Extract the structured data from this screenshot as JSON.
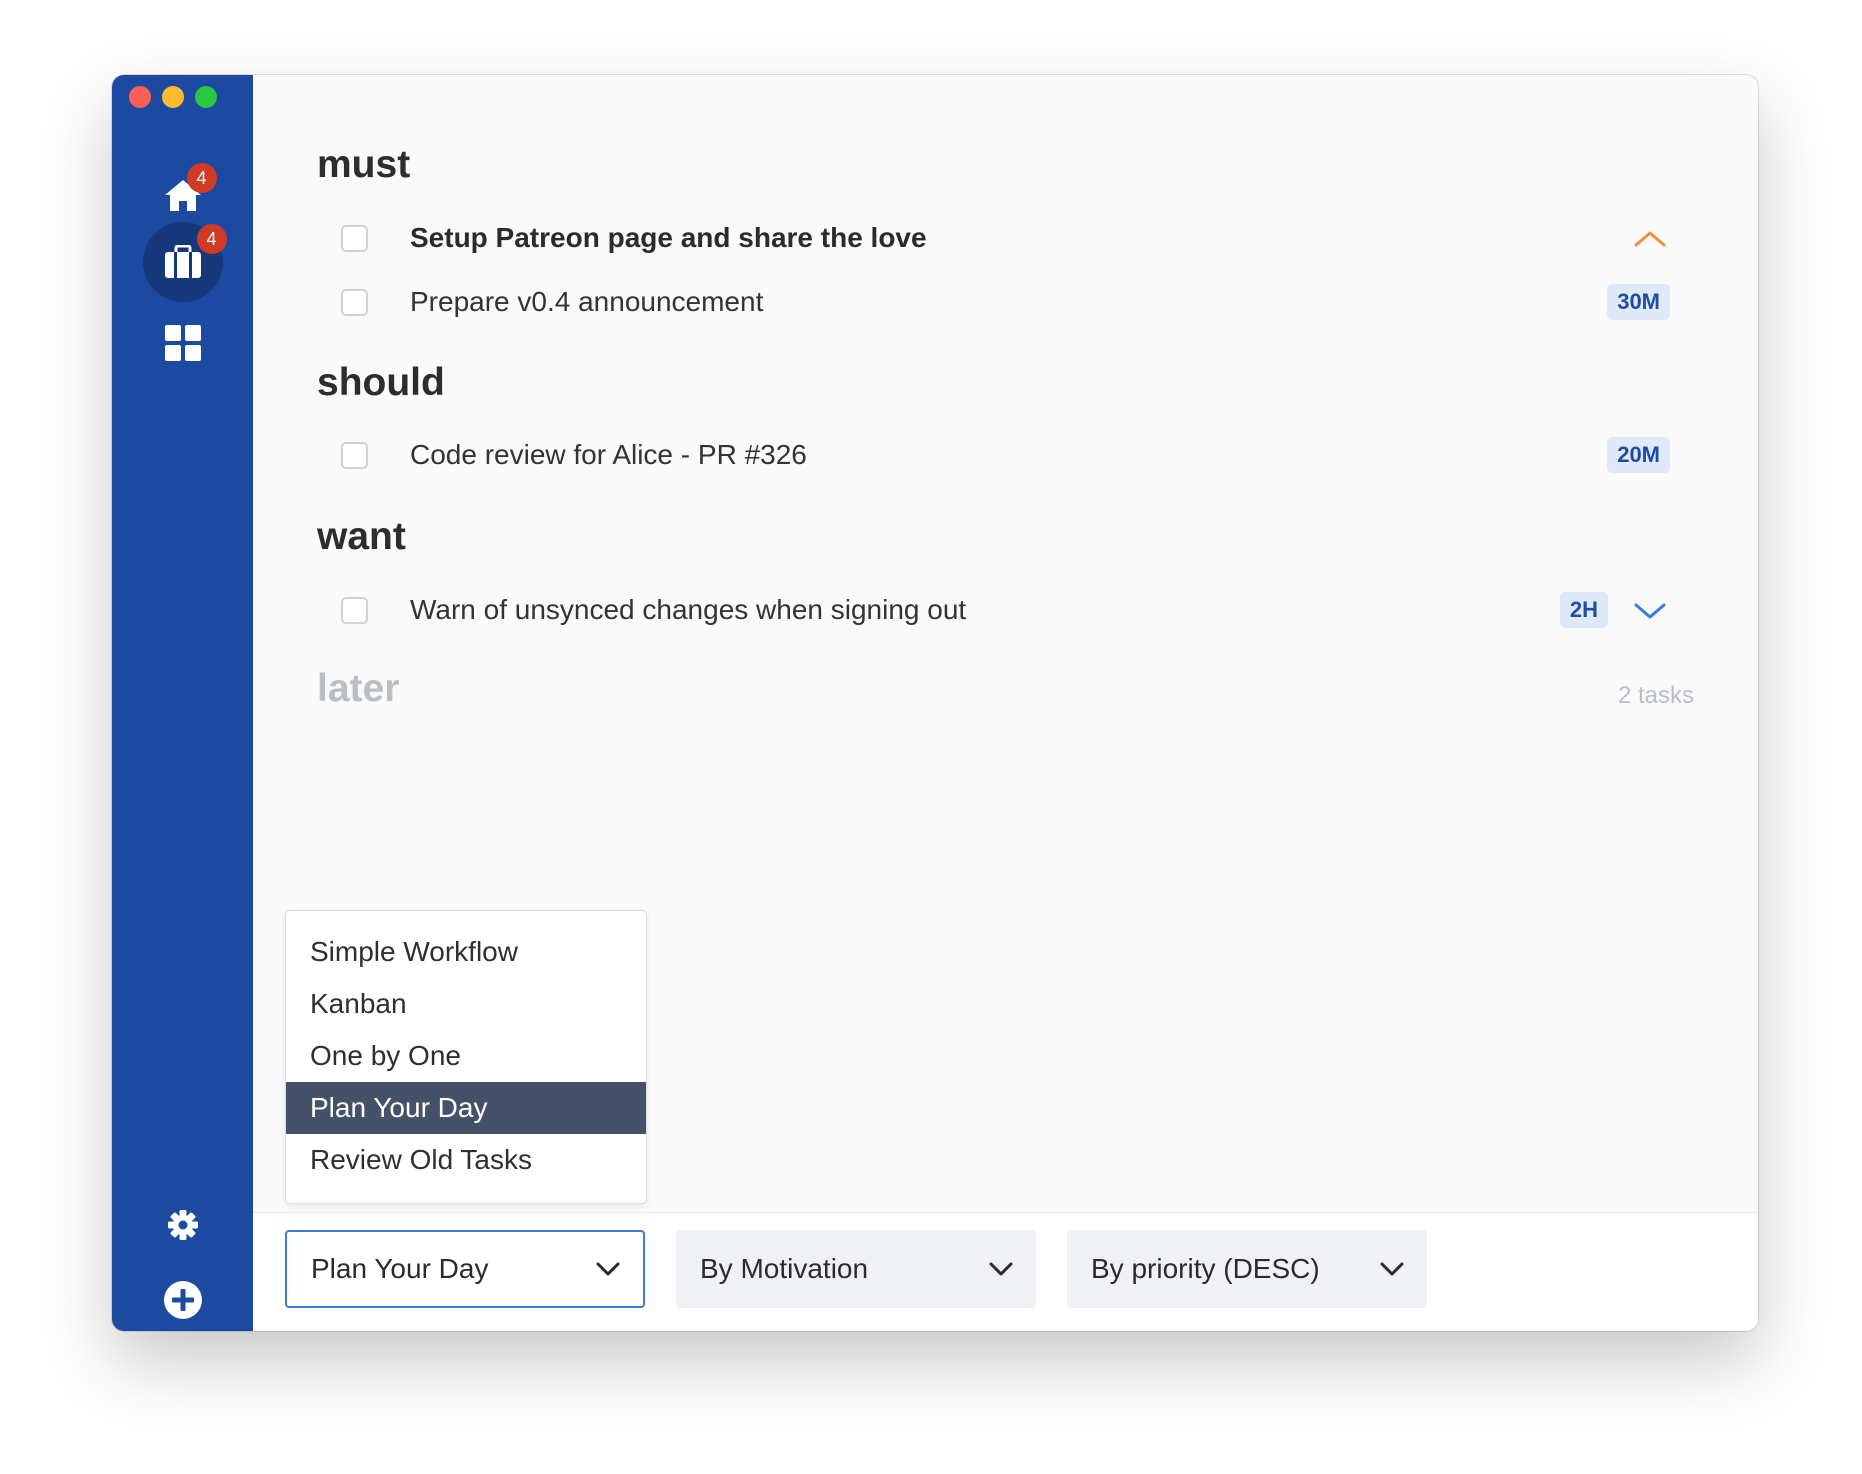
{
  "sidebar": {
    "home_badge": "4",
    "work_badge": "4",
    "icons": [
      "home-icon",
      "briefcase-icon",
      "grid-icon",
      "gear-icon",
      "plus-circle-icon"
    ]
  },
  "sections": {
    "must": {
      "title": "must",
      "tasks": [
        {
          "label": "Setup Patreon page and share the love"
        },
        {
          "label": "Prepare v0.4 announcement",
          "duration": "30M"
        }
      ]
    },
    "should": {
      "title": "should",
      "tasks": [
        {
          "label": "Code review for Alice - PR #326",
          "duration": "20M"
        }
      ]
    },
    "want": {
      "title": "want",
      "tasks": [
        {
          "label": "Warn of unsynced changes when signing out",
          "duration": "2H"
        }
      ]
    },
    "later": {
      "title": "later",
      "count": "2 tasks"
    }
  },
  "workflow_menu": {
    "items": [
      "Simple Workflow",
      "Kanban",
      "One by One",
      "Plan Your Day",
      "Review Old Tasks"
    ],
    "selected": "Plan Your Day"
  },
  "footer": {
    "workflow_select": "Plan Your Day",
    "group_select": "By Motivation",
    "sort_select": "By priority (DESC)"
  },
  "colors": {
    "sidebar": "#1c4aa0",
    "badge": "#d13b26",
    "high_priority": "#f0913a",
    "low_priority": "#3b7be0",
    "menu_selected": "#455069"
  }
}
